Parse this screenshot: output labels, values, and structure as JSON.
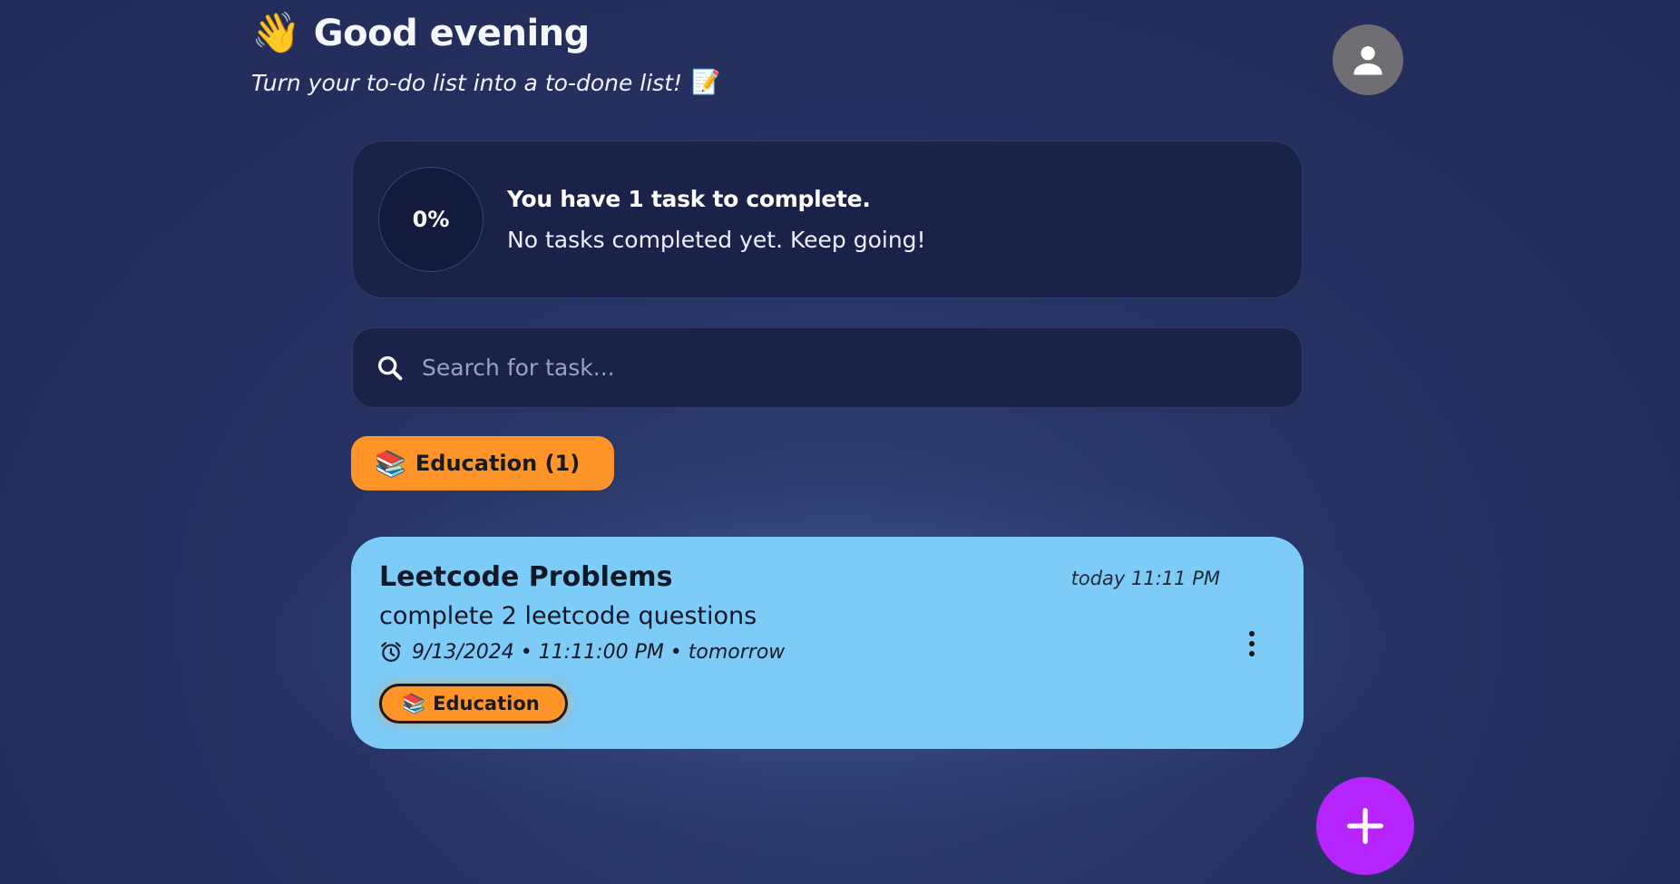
{
  "header": {
    "wave_emoji": "👋",
    "greeting": "Good evening",
    "subtitle": "Turn your to-do list into a to-done list!",
    "subtitle_emoji": "📝"
  },
  "avatar": {
    "icon": "person-icon",
    "color": "#6f6f73"
  },
  "progress": {
    "percent_label": "0%",
    "percent_value": 0,
    "heading": "You have 1 task to complete.",
    "message": "No tasks completed yet. Keep going!"
  },
  "search": {
    "placeholder": "Search for task...",
    "value": ""
  },
  "categories": [
    {
      "emoji": "📚",
      "label": "Education (1)",
      "color": "#ff9529"
    }
  ],
  "tasks": [
    {
      "title": "Leetcode Problems",
      "created": "today 11:11 PM",
      "description": "complete 2 leetcode questions",
      "due": "9/13/2024 • 11:11:00 PM • tomorrow",
      "tag_emoji": "📚",
      "tag_label": "Education",
      "color": "#7dcbf7"
    }
  ],
  "fab": {
    "icon": "plus-icon",
    "color": "#b624ff"
  },
  "colors": {
    "background": "#232d5c",
    "card": "#1b2249",
    "accent_orange": "#ff9529",
    "accent_purple": "#b624ff"
  }
}
